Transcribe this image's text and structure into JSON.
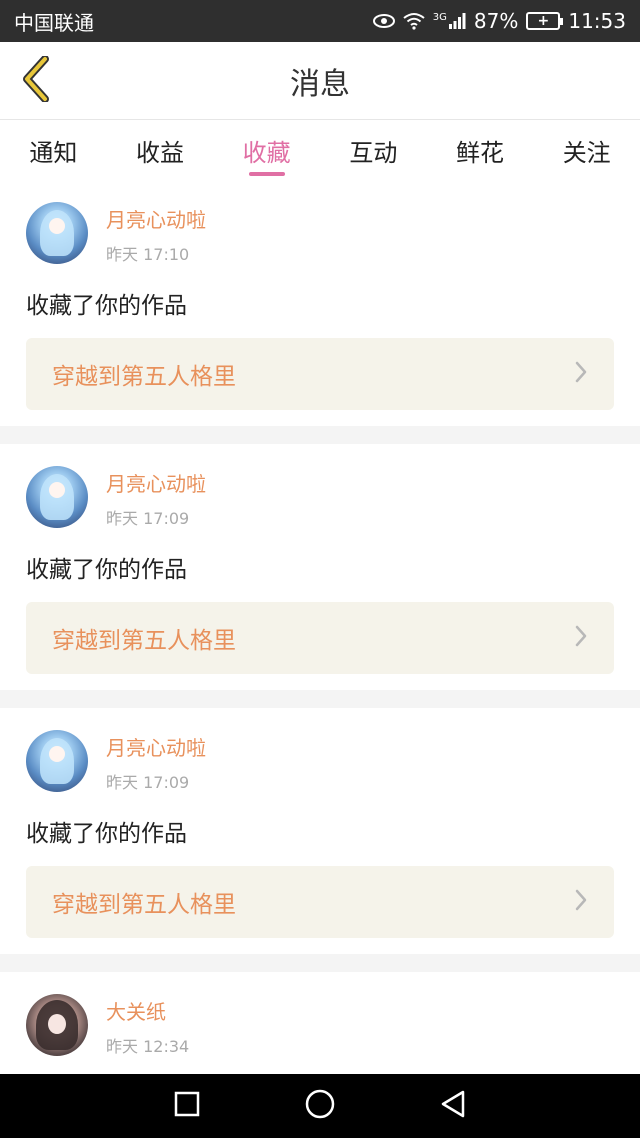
{
  "status_bar": {
    "carrier": "中国联通",
    "network": "3G",
    "battery": "87%",
    "time": "11:53"
  },
  "header": {
    "title": "消息",
    "back_icon": "chevron-left-icon"
  },
  "tabs": [
    {
      "label": "通知",
      "active": false
    },
    {
      "label": "收益",
      "active": false
    },
    {
      "label": "收藏",
      "active": true
    },
    {
      "label": "互动",
      "active": false
    },
    {
      "label": "鲜花",
      "active": false
    },
    {
      "label": "关注",
      "active": false
    }
  ],
  "messages": [
    {
      "user": "月亮心动啦",
      "time": "昨天 17:10",
      "action": "收藏了你的作品",
      "work": "穿越到第五人格里"
    },
    {
      "user": "月亮心动啦",
      "time": "昨天 17:09",
      "action": "收藏了你的作品",
      "work": "穿越到第五人格里"
    },
    {
      "user": "月亮心动啦",
      "time": "昨天 17:09",
      "action": "收藏了你的作品",
      "work": "穿越到第五人格里"
    },
    {
      "user": "大关纸",
      "time": "昨天 12:34"
    }
  ],
  "colors": {
    "accent_pink": "#e06fa4",
    "username_orange": "#e8915c",
    "link_bg": "#f5f3ea",
    "back_arrow_yellow": "#e8c73a"
  }
}
